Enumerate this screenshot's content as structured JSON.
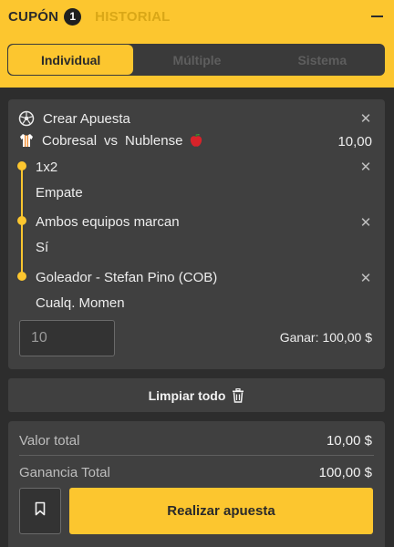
{
  "header": {
    "tab_cupon": "CUPÓN",
    "cupon_count": "1",
    "tab_historial": "HISTORIAL",
    "bet_types": [
      "Individual",
      "Múltiple",
      "Sistema"
    ],
    "active_bet_type": "Individual"
  },
  "bet": {
    "title": "Crear Apuesta",
    "home_team": "Cobresal",
    "vs": "vs",
    "away_team": "Nublense",
    "odds": "10,00",
    "selections": [
      {
        "market": "1x2",
        "pick": "Empate"
      },
      {
        "market": "Ambos equipos marcan",
        "pick": "Sí"
      },
      {
        "market": "Goleador - Stefan Pino (COB)",
        "pick": "Cualq. Momen"
      }
    ],
    "stake_placeholder": "10",
    "win_label": "Ganar:",
    "win_value": "100,00 $"
  },
  "clear_all": {
    "label": "Limpiar todo"
  },
  "summary": {
    "total_label": "Valor total",
    "total_value": "10,00 $",
    "gain_label": "Ganancia Total",
    "gain_value": "100,00 $",
    "place_bet_label": "Realizar apuesta"
  },
  "icons": {
    "soccer": "soccer-ball-icon",
    "jersey": "jersey-icon",
    "team_badge": "apple-icon",
    "trash": "trash-icon",
    "bookmark": "bookmark-icon",
    "close": "close-icon",
    "collapse": "minus-icon"
  },
  "colors": {
    "accent": "#fcc62f",
    "panel": "#404040",
    "background": "#2d2d2d"
  }
}
